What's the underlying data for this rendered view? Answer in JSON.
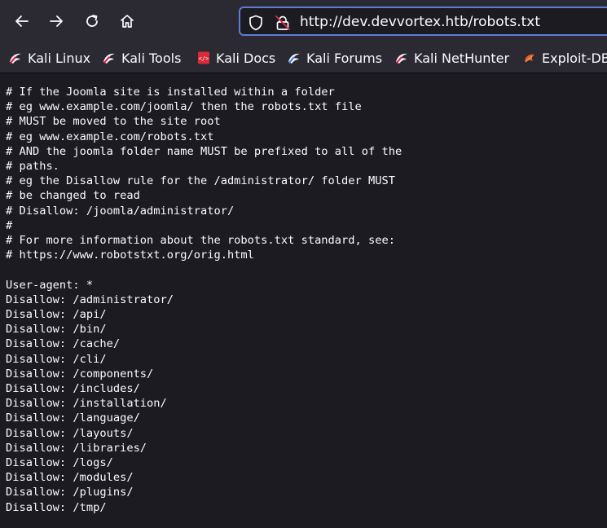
{
  "browser": {
    "url": "http://dev.devvortex.htb/robots.txt",
    "nav": {
      "back_icon": "arrow-left-icon",
      "forward_icon": "arrow-right-icon",
      "reload_icon": "reload-icon",
      "home_icon": "home-icon"
    },
    "colors": {
      "toolbar": "#2b2a33",
      "page_bg": "#1c1b22",
      "url_focus": "#5c7ed9"
    }
  },
  "bookmarks": [
    {
      "label": "Kali Linux",
      "icon": "kali-dragon-icon"
    },
    {
      "label": "Kali Tools",
      "icon": "kali-dragon-icon"
    },
    {
      "label": "Kali Docs",
      "icon": "kali-docs-icon"
    },
    {
      "label": "Kali Forums",
      "icon": "kali-forums-icon"
    },
    {
      "label": "Kali NetHunter",
      "icon": "kali-dragon-icon"
    },
    {
      "label": "Exploit-DB",
      "icon": "exploit-db-icon"
    }
  ],
  "page": {
    "content": "# If the Joomla site is installed within a folder\n# eg www.example.com/joomla/ then the robots.txt file\n# MUST be moved to the site root\n# eg www.example.com/robots.txt\n# AND the joomla folder name MUST be prefixed to all of the\n# paths.\n# eg the Disallow rule for the /administrator/ folder MUST\n# be changed to read\n# Disallow: /joomla/administrator/\n#\n# For more information about the robots.txt standard, see:\n# https://www.robotstxt.org/orig.html\n\nUser-agent: *\nDisallow: /administrator/\nDisallow: /api/\nDisallow: /bin/\nDisallow: /cache/\nDisallow: /cli/\nDisallow: /components/\nDisallow: /includes/\nDisallow: /installation/\nDisallow: /language/\nDisallow: /layouts/\nDisallow: /libraries/\nDisallow: /logs/\nDisallow: /modules/\nDisallow: /plugins/\nDisallow: /tmp/"
  }
}
